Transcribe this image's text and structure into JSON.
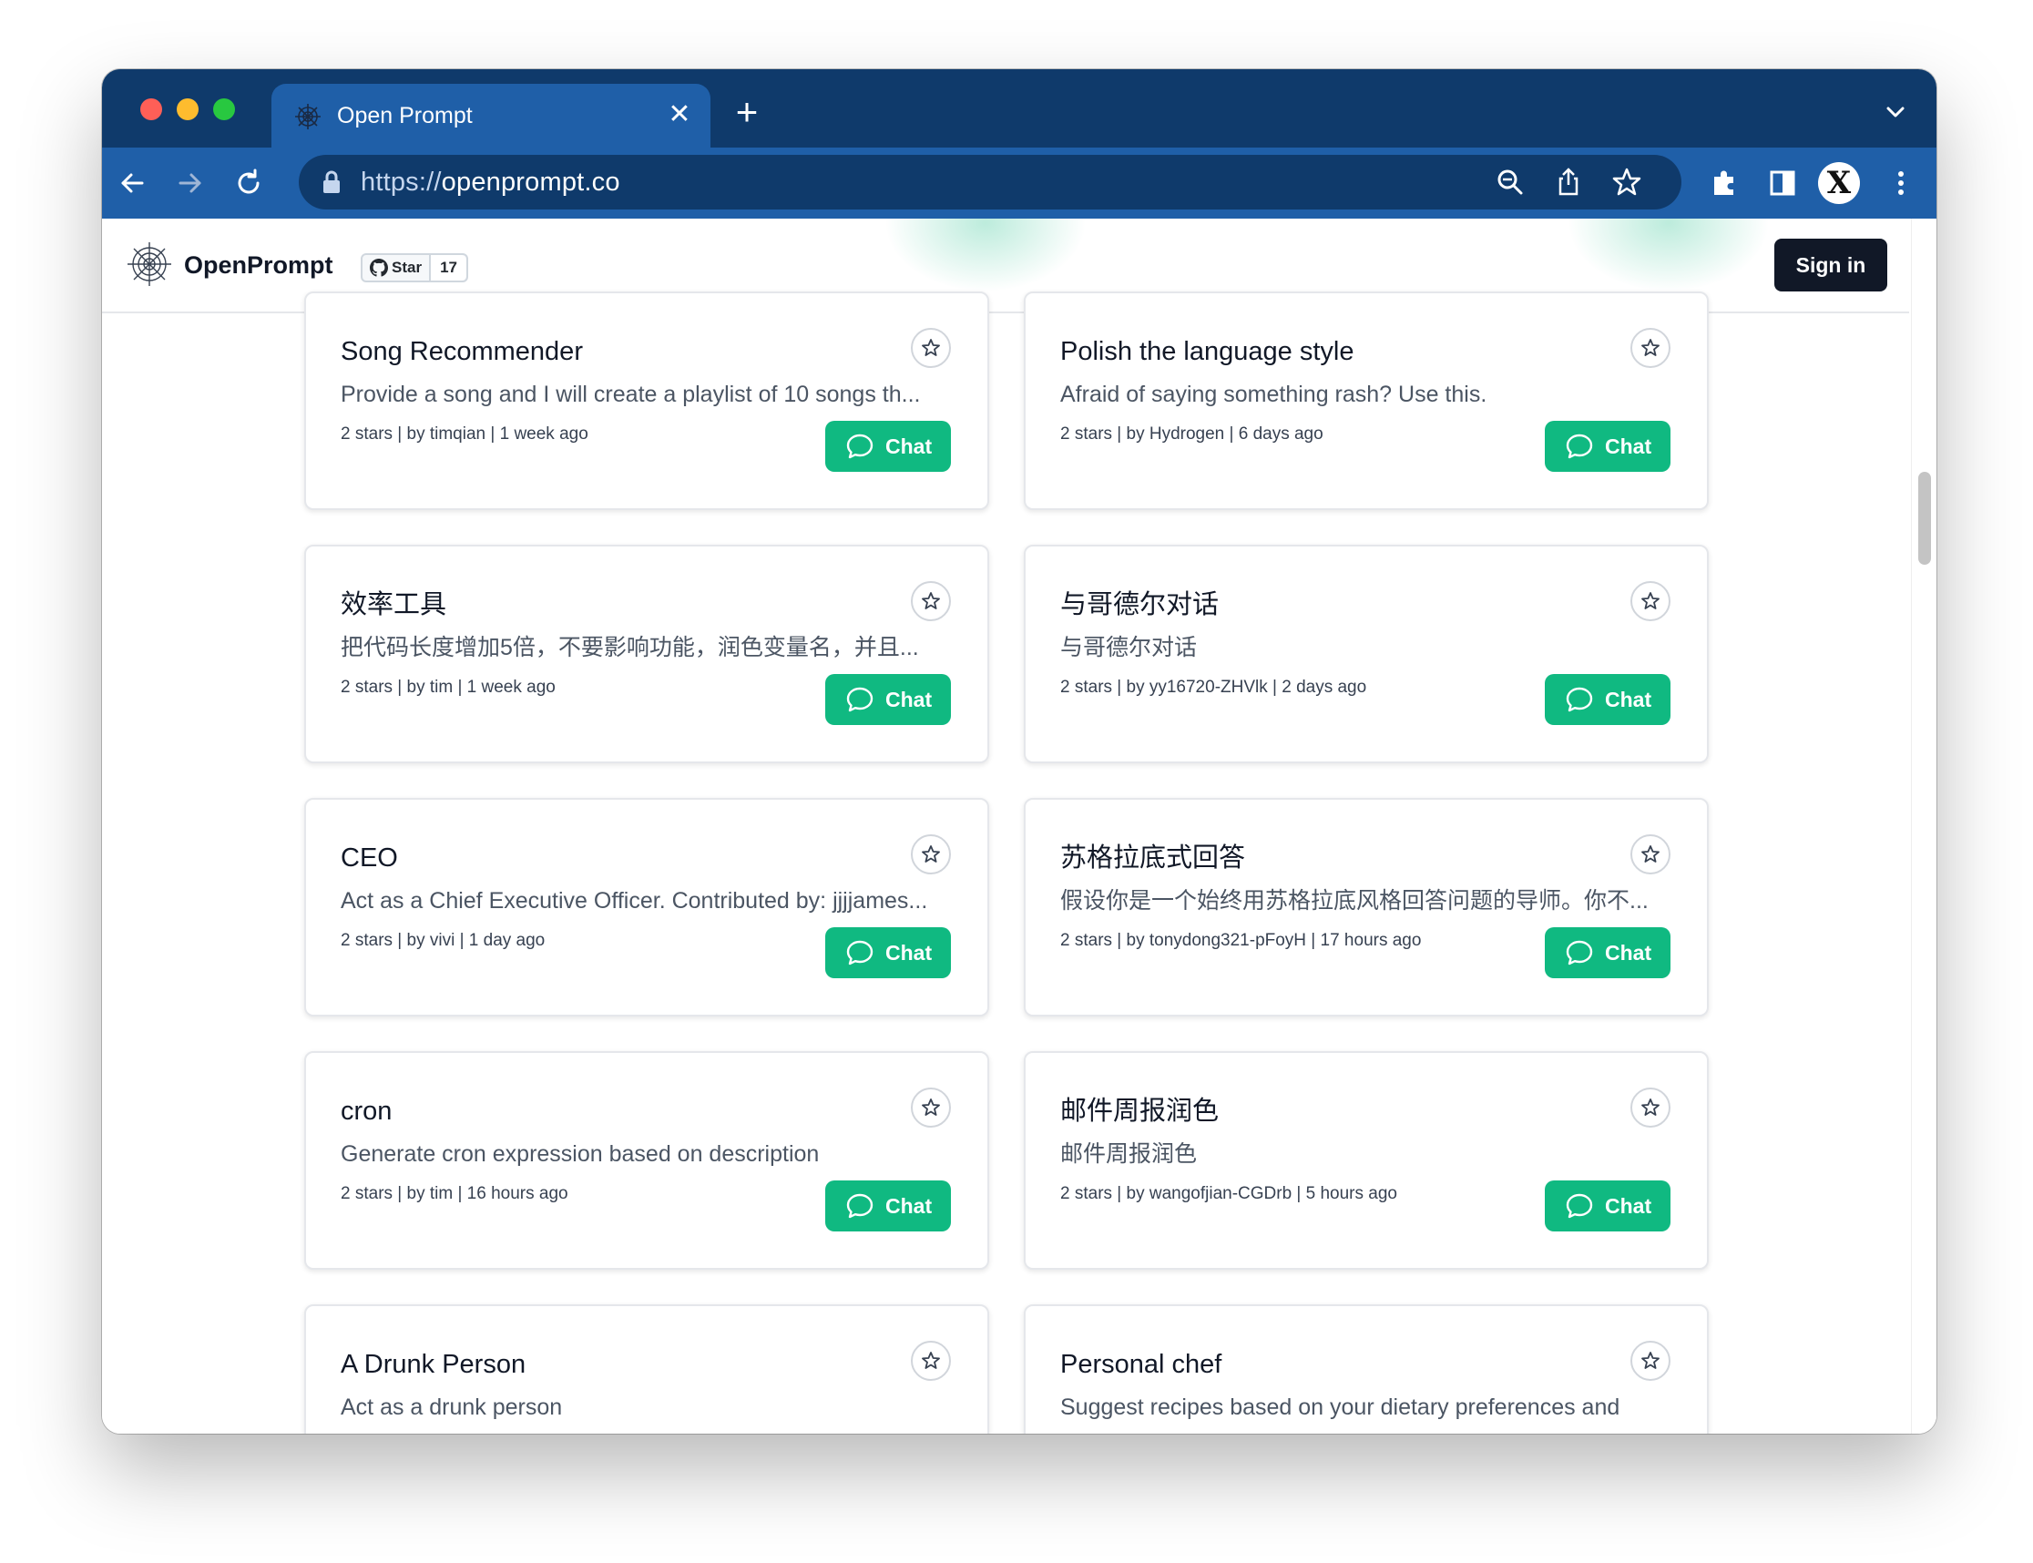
{
  "browser": {
    "tab_title": "Open Prompt",
    "new_tab_symbol": "+",
    "close_symbol": "✕",
    "url_scheme": "https://",
    "url_host": "openprompt.co",
    "profile_initial": "X"
  },
  "header": {
    "logo_text": "OpenPrompt",
    "github_star_label": "Star",
    "github_star_count": "17",
    "signin_label": "Sign in"
  },
  "cards": [
    {
      "title": "Song Recommender",
      "description": "Provide a song and I will create a playlist of 10 songs th...",
      "meta": "2 stars | by timqian | 1 week ago",
      "chat_label": "Chat"
    },
    {
      "title": "Polish the language style",
      "description": "Afraid of saying something rash? Use this.",
      "meta": "2 stars | by Hydrogen | 6 days ago",
      "chat_label": "Chat"
    },
    {
      "title": "效率工具",
      "description": "把代码长度增加5倍，不要影响功能，润色变量名，并且...",
      "meta": "2 stars | by tim | 1 week ago",
      "chat_label": "Chat"
    },
    {
      "title": "与哥德尔对话",
      "description": "与哥德尔对话",
      "meta": "2 stars | by yy16720-ZHVlk | 2 days ago",
      "chat_label": "Chat"
    },
    {
      "title": "CEO",
      "description": "Act as a Chief Executive Officer. Contributed by: jjjjames...",
      "meta": "2 stars | by vivi | 1 day ago",
      "chat_label": "Chat"
    },
    {
      "title": "苏格拉底式回答",
      "description": "假设你是一个始终用苏格拉底风格回答问题的导师。你不...",
      "meta": "2 stars | by tonydong321-pFoyH | 17 hours ago",
      "chat_label": "Chat"
    },
    {
      "title": "cron",
      "description": "Generate cron expression based on description",
      "meta": "2 stars | by tim | 16 hours ago",
      "chat_label": "Chat"
    },
    {
      "title": "邮件周报润色",
      "description": "邮件周报润色",
      "meta": "2 stars | by wangofjian-CGDrb | 5 hours ago",
      "chat_label": "Chat"
    },
    {
      "title": "A Drunk Person",
      "description": "Act as a drunk person",
      "meta": "",
      "chat_label": ""
    },
    {
      "title": "Personal chef",
      "description": "Suggest recipes based on your dietary preferences and",
      "meta": "",
      "chat_label": ""
    }
  ],
  "colors": {
    "tab_strip": "#0f3a6b",
    "toolbar": "#1f5fa8",
    "accent_green": "#10b981",
    "signin_bg": "#111827"
  },
  "icons": [
    "spider-web-icon",
    "close-icon",
    "plus-icon",
    "chevron-down-icon",
    "back-arrow-icon",
    "forward-arrow-icon",
    "reload-icon",
    "lock-icon",
    "zoom-icon",
    "share-icon",
    "bookmark-star-icon",
    "extensions-icon",
    "sidebar-icon",
    "more-vert-icon",
    "github-icon",
    "star-icon",
    "chat-bubble-icon"
  ]
}
